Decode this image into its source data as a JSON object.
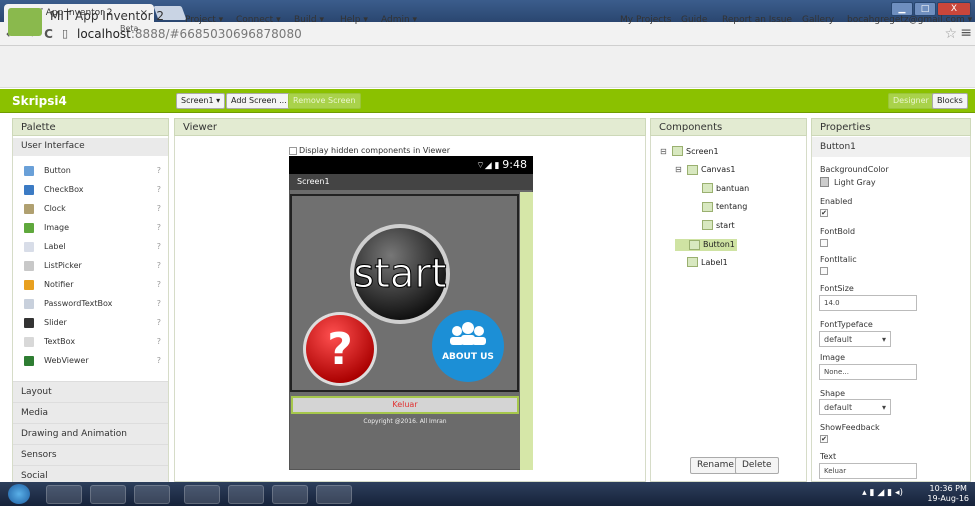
{
  "browser": {
    "tab_title": "MIT App Inventor 2",
    "tab_close": "×",
    "url_host": "localhost",
    "url_rest": ":8888/#6685030696878080",
    "star": "☆",
    "menu": "≡"
  },
  "window": {
    "minimize": "▁",
    "maximize": "□",
    "close": "X"
  },
  "header": {
    "brand": "MIT App Inventor 2",
    "beta": "Beta",
    "menus": [
      "Project ▾",
      "Connect ▾",
      "Build ▾",
      "Help ▾",
      "Admin ▾"
    ],
    "right_links": [
      "My Projects",
      "Guide",
      "Report an Issue",
      "Gallery",
      "bocahgregetz@gmail.com ▾"
    ]
  },
  "toolbar": {
    "project_name": "Skripsi4",
    "screen_select": "Screen1 ▾",
    "add_screen": "Add Screen ...",
    "remove_screen": "Remove Screen",
    "designer": "Designer",
    "blocks": "Blocks"
  },
  "palette": {
    "title": "Palette",
    "section": "User Interface",
    "items": [
      {
        "label": "Button",
        "color": "#6aa0d8"
      },
      {
        "label": "CheckBox",
        "color": "#3c7bc4"
      },
      {
        "label": "Clock",
        "color": "#b0a070"
      },
      {
        "label": "Image",
        "color": "#5fa83c"
      },
      {
        "label": "Label",
        "color": "#d8dde8"
      },
      {
        "label": "ListPicker",
        "color": "#c8c8c8"
      },
      {
        "label": "Notifier",
        "color": "#e8a020"
      },
      {
        "label": "PasswordTextBox",
        "color": "#c8d0dc"
      },
      {
        "label": "Slider",
        "color": "#333333"
      },
      {
        "label": "TextBox",
        "color": "#d8d8d8"
      },
      {
        "label": "WebViewer",
        "color": "#2e7d32"
      }
    ],
    "help": "?",
    "categories": [
      "Layout",
      "Media",
      "Drawing and Animation",
      "Sensors",
      "Social"
    ]
  },
  "viewer": {
    "title": "Viewer",
    "hidden_toggle": "Display hidden components in Viewer",
    "status": "9:48",
    "screen_title": "Screen1",
    "start_text": "start",
    "about_text": "ABOUT US",
    "button_text": "Keluar",
    "copyright": "Copyright @2016. All Imran"
  },
  "components": {
    "title": "Components",
    "tree": [
      {
        "label": "Screen1",
        "toggle": "⊟"
      },
      {
        "label": "Canvas1",
        "toggle": "⊟"
      },
      {
        "label": "bantuan",
        "toggle": ""
      },
      {
        "label": "tentang",
        "toggle": ""
      },
      {
        "label": "start",
        "toggle": ""
      },
      {
        "label": "Button1",
        "toggle": ""
      },
      {
        "label": "Label1",
        "toggle": ""
      }
    ],
    "rename": "Rename",
    "delete": "Delete"
  },
  "properties": {
    "title": "Properties",
    "component": "Button1",
    "bg_label": "BackgroundColor",
    "bg_value": "Light Gray",
    "enabled_label": "Enabled",
    "fontbold_label": "FontBold",
    "fontitalic_label": "FontItalic",
    "fontsize_label": "FontSize",
    "fontsize_value": "14.0",
    "typeface_label": "FontTypeface",
    "typeface_value": "default",
    "image_label": "Image",
    "image_value": "None...",
    "shape_label": "Shape",
    "shape_value": "default",
    "feedback_label": "ShowFeedback",
    "text_label": "Text",
    "text_value": "Keluar",
    "check": "✔"
  },
  "taskbar": {
    "time": "10:36 PM",
    "date": "19-Aug-16"
  },
  "colors": {
    "accent": "#8bc100",
    "header_bg": "#f0f0f0"
  }
}
